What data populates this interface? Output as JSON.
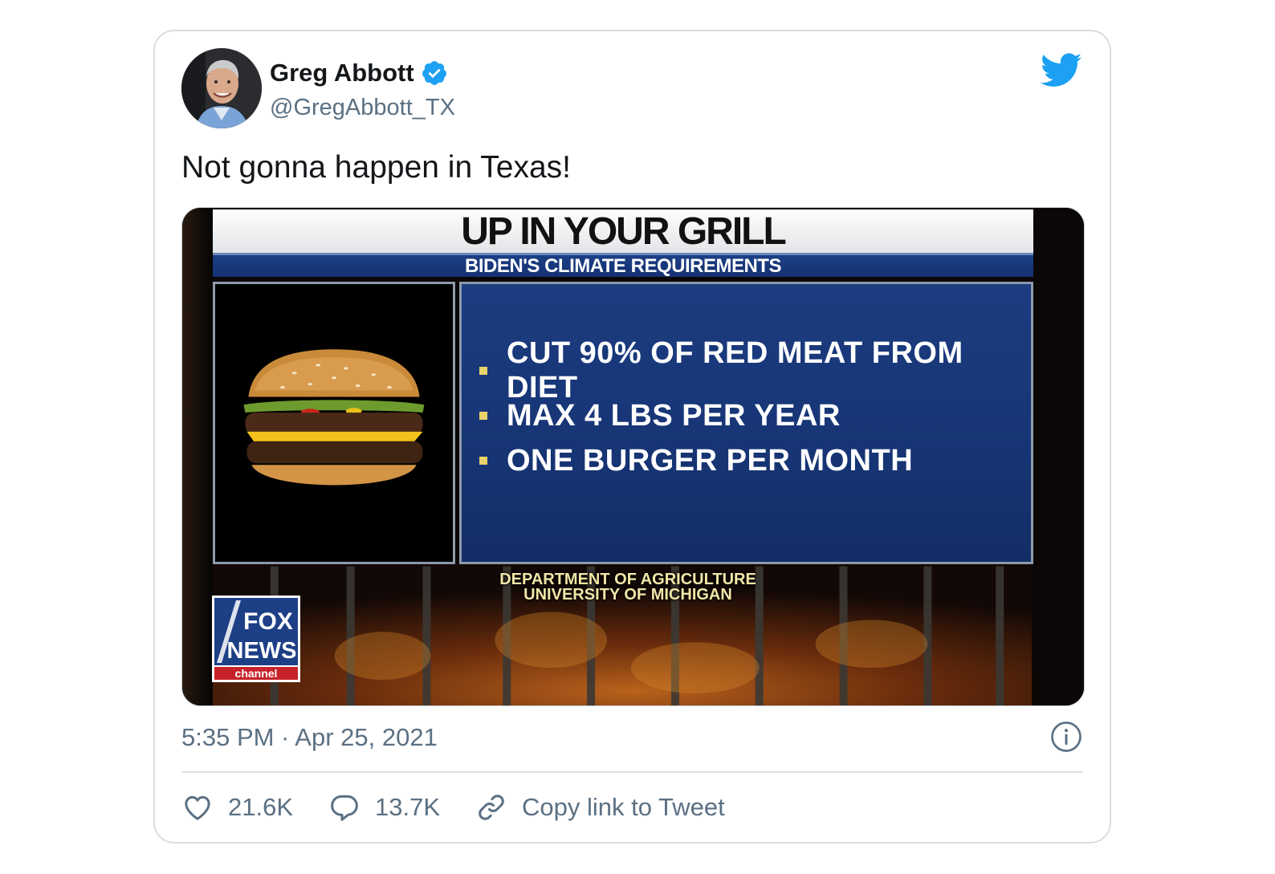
{
  "tweet": {
    "display_name": "Greg Abbott",
    "handle": "@GregAbbott_TX",
    "verified": true,
    "text": "Not gonna happen in Texas!",
    "timestamp": "5:35 PM · Apr 25, 2021",
    "accent_color": "#1da1f2"
  },
  "media": {
    "title": "UP IN YOUR GRILL",
    "subtitle": "BIDEN'S CLIMATE REQUIREMENTS",
    "requirements": [
      "CUT 90% OF RED MEAT FROM DIET",
      "MAX 4 LBS PER YEAR",
      "ONE BURGER PER MONTH"
    ],
    "source_line1": "DEPARTMENT OF AGRICULTURE",
    "source_line2": "UNIVERSITY OF MICHIGAN",
    "logo_line1": "FOX",
    "logo_line2": "NEWS",
    "logo_line3": "channel"
  },
  "actions": {
    "likes": "21.6K",
    "replies": "13.7K",
    "copy_link": "Copy link to Tweet"
  },
  "icons": {
    "like": "heart-icon",
    "reply": "speech-bubble-icon",
    "copy": "link-icon",
    "info": "info-icon",
    "brand": "twitter-bird-icon",
    "verified": "verified-badge-icon"
  }
}
